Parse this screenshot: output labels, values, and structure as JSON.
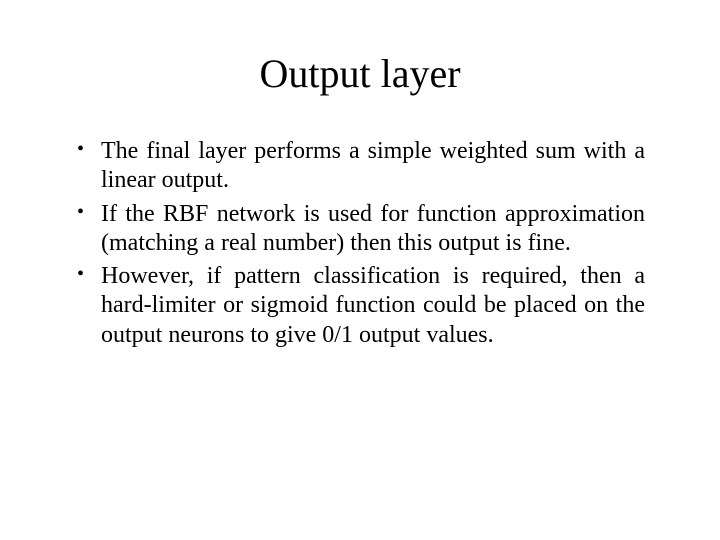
{
  "slide": {
    "title": "Output layer",
    "bullets": [
      "The final layer performs a simple weighted sum with a linear output.",
      "If the RBF network is used for function approximation (matching a real number) then this output is fine.",
      "However, if pattern classification is required, then a hard-limiter or sigmoid function could be placed on the output neurons to give 0/1 output values."
    ]
  }
}
